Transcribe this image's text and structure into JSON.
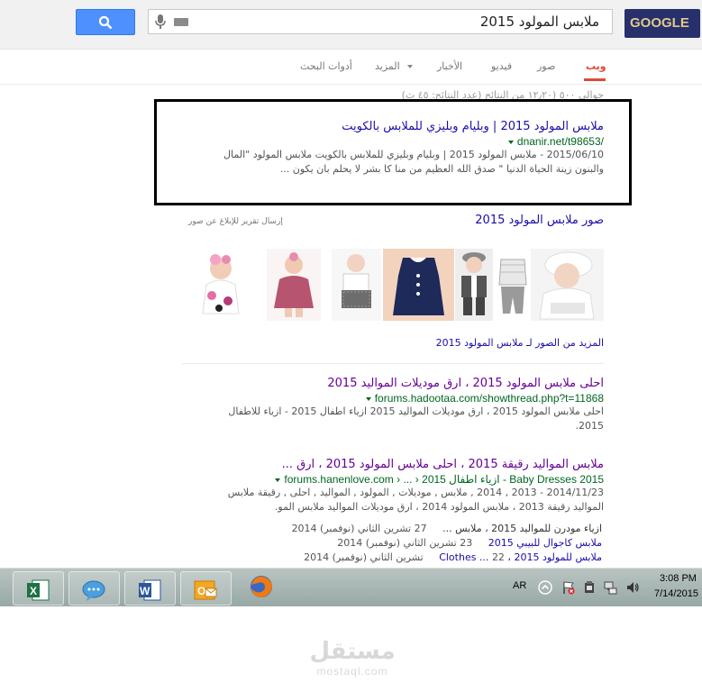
{
  "search": {
    "query": "ملابس المولود 2015",
    "logo_text": "GOOGLE"
  },
  "tabs": [
    {
      "label": "ويب",
      "active": true
    },
    {
      "label": "صور"
    },
    {
      "label": "فيديو"
    },
    {
      "label": "الأخبار"
    },
    {
      "label": "المزيد"
    },
    {
      "label": "أدوات البحث"
    }
  ],
  "stats_text": "حوالي ٥٠٠ (١٢٫٢٠ من النتائج (عدد النتائج: ٤٥ ث)",
  "result1": {
    "title": "ملابس المولود 2015 | وبليام وبليزي للملابس بالكويت",
    "url": "dnanir.net/t98653/",
    "snippet1": "2015/06/10 - ملابس المولود 2015 | وبليام وبليزي للملابس بالكويت ملابس المولود \"المال",
    "snippet2": "والبنون زينة الحياة الدنيا \" صدق الله العظيم من منا كا بشر لا يحلم بان يكون ..."
  },
  "images": {
    "heading": "صور ملابس المولود 2015",
    "report": "إرسال تقرير للإبلاغ عن صور",
    "more": "المزيد من الصور لـ ملابس المولود 2015"
  },
  "result2": {
    "title": "احلى ملابس المولود 2015 ، ارق موديلات المواليد 2015",
    "url": "forums.hadootaa.com/showthread.php?t=11868",
    "snippet1": "احلى ملابس المولود 2015 ، ارق موديلات المواليد 2015 ازياء اطفال 2015 - ازياء للاطفال",
    "snippet2": "2015."
  },
  "result3": {
    "title": "ملابس المواليد رقيقة 2015 ، احلى ملابس المولود 2015 ، ارق ...",
    "url": "forums.hanenlove.com › ... › ازياء اطفال 2015 - Baby Dresses 2015",
    "snippet1": "2014/11/23 - 2013 , 2014 , ملابس , موديلات , المولود , المواليد , احلى , رقيقة ملابس",
    "snippet2": "المواليد رقيقة 2013 ، ملابس المولود 2014 ، ارق موديلات المواليد ملابس المو.",
    "sitelinks": [
      {
        "text": "ازياء مودرن للمواليد 2015 ، ملابس ...",
        "date": "27 تشرين الثاني (نوفمبر) 2014"
      },
      {
        "text": "ملابس كاجوال للبيبي 2015",
        "date": "23 تشرين الثاني (نوفمبر) 2014"
      },
      {
        "text": "ملابس للمولود 2015 ، Clothes ...",
        "date": "22 تشرين الثاني (نوفمبر) 2014"
      }
    ]
  },
  "tray": {
    "lang": "AR",
    "time": "3:08 PM",
    "date": "7/14/2015"
  },
  "watermark": {
    "arabic": "مستقل",
    "latin": "mostaql.com"
  }
}
